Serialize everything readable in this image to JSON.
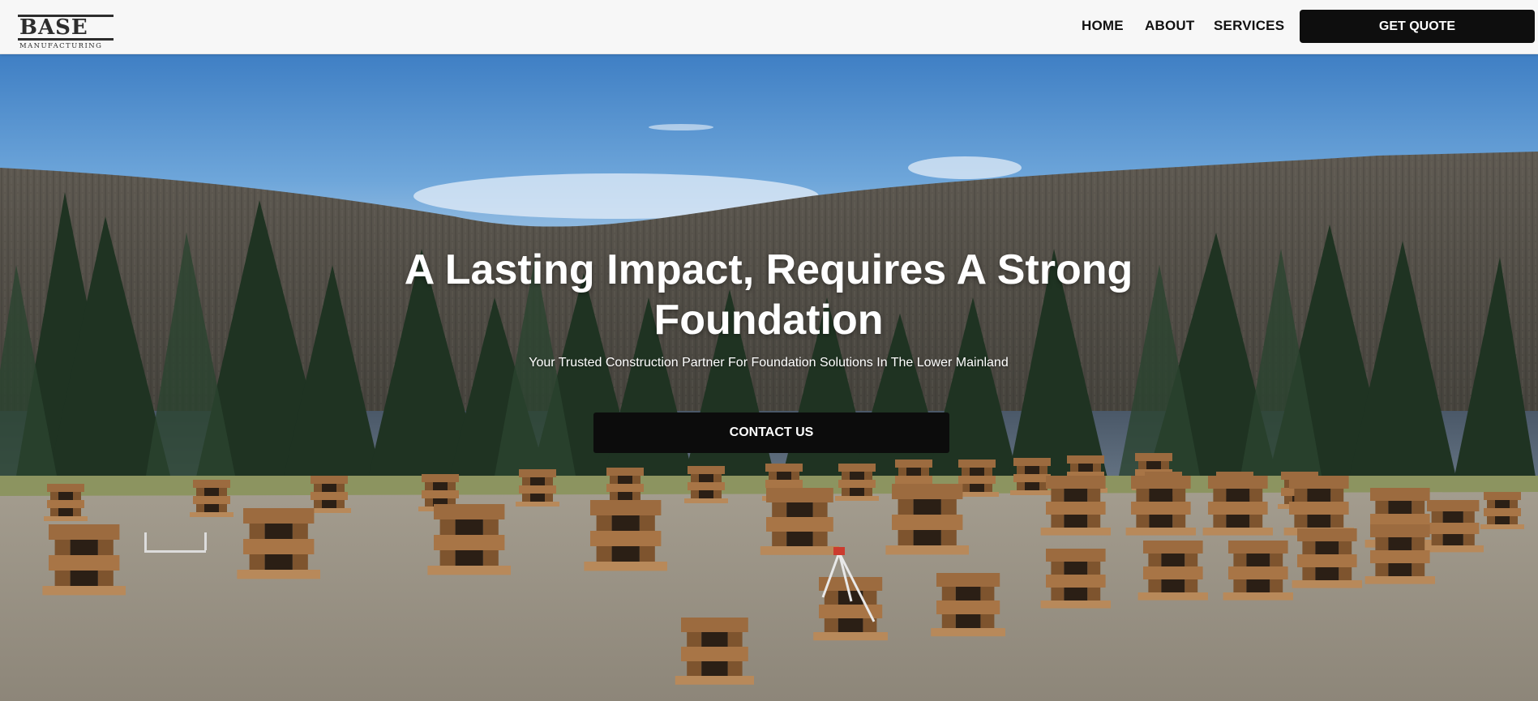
{
  "logo": {
    "main": "BASE",
    "sub": "MANUFACTURING"
  },
  "nav": {
    "items": [
      {
        "label": "HOME"
      },
      {
        "label": "ABOUT"
      },
      {
        "label": "SERVICES"
      }
    ],
    "cta_label": "GET QUOTE"
  },
  "hero": {
    "title": "A Lasting Impact, Requires A Strong Foundation",
    "subtitle": "Your Trusted Construction Partner For Foundation Solutions In The Lower Mainland",
    "button_label": "CONTACT US",
    "background": "hero-photo-timber-cribbing-lakeside"
  },
  "colors": {
    "header_bg": "#f7f7f7",
    "button_bg": "#0e0e0e",
    "text_dark": "#111111",
    "sky": "#4f8fcf",
    "timber": "#8a5d36"
  }
}
